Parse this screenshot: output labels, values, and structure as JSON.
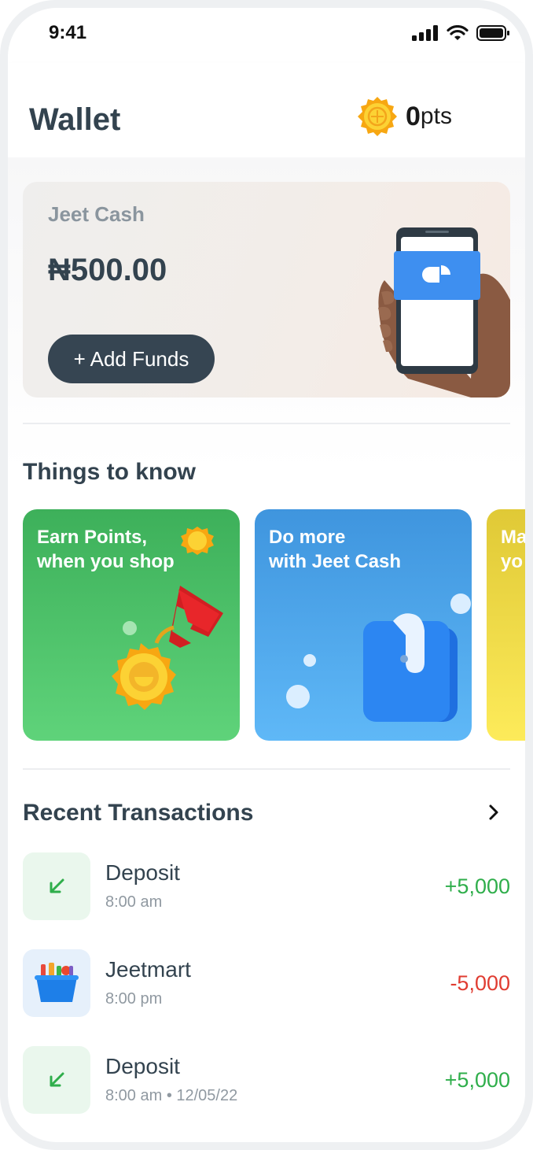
{
  "status": {
    "time": "9:41"
  },
  "header": {
    "title": "Wallet",
    "points_value": "0",
    "points_unit": "pts"
  },
  "cash_card": {
    "label": "Jeet Cash",
    "amount": "₦500.00",
    "add_funds_label": "+ Add Funds"
  },
  "things_to_know": {
    "title": "Things to know",
    "cards": [
      {
        "text": "Earn Points,\nwhen you shop",
        "color": "#45b862"
      },
      {
        "text": "Do more\nwith Jeet Cash",
        "color": "#4aa3e8"
      },
      {
        "text": "Ma\nyo",
        "color": "#efd947"
      }
    ]
  },
  "transactions": {
    "title": "Recent Transactions",
    "items": [
      {
        "name": "Deposit",
        "time": "8:00 am",
        "amount": "+5,000",
        "icon": "arrow-down-left-icon"
      },
      {
        "name": "Jeetmart",
        "time": "8:00 pm",
        "amount": "-5,000",
        "icon": "shopping-basket-icon"
      },
      {
        "name": "Deposit",
        "time": "8:00 am • 12/05/22",
        "amount": "+5,000",
        "icon": "arrow-down-left-icon"
      }
    ]
  },
  "colors": {
    "positive": "#2fae4b",
    "negative": "#e03c31",
    "primary_text": "#33434f",
    "button": "#364552"
  }
}
